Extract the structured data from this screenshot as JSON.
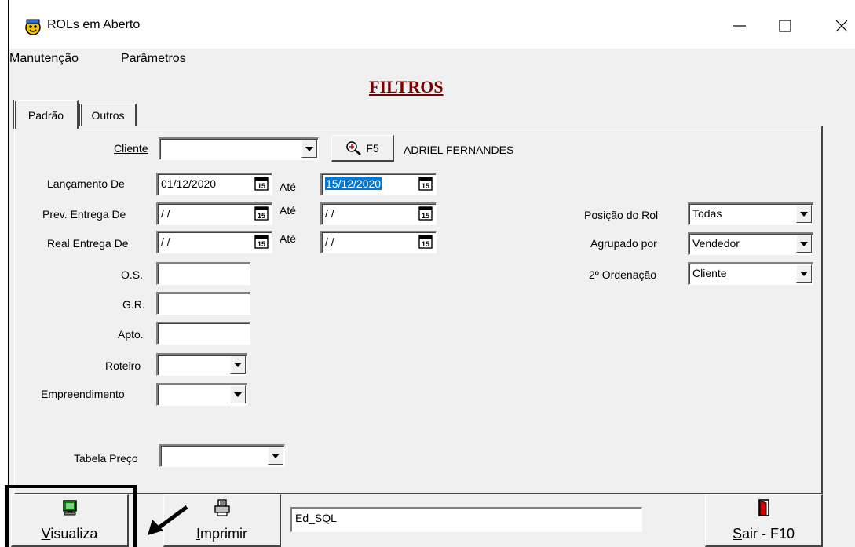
{
  "window": {
    "title": "ROLs em Aberto",
    "controls": {
      "minimize": "—",
      "maximize": "☐",
      "close": "✕"
    }
  },
  "menu": {
    "items": [
      "Manutenção",
      "Parâmetros"
    ]
  },
  "header": {
    "title": "FILTROS"
  },
  "tabs": [
    {
      "label": "Padrão",
      "active": true
    },
    {
      "label": "Outros",
      "active": false
    }
  ],
  "form": {
    "cliente": {
      "label": "Cliente",
      "value": "",
      "lookup_label": "F5",
      "client_name": "ADRIEL FERNANDES"
    },
    "lancamento": {
      "label": "Lançamento De",
      "from": "01/12/2020",
      "to_label": "Até",
      "to": "15/12/2020"
    },
    "prev_entrega": {
      "label": "Prev. Entrega De",
      "from": " / /",
      "to_label": "Até",
      "to": " / /"
    },
    "real_entrega": {
      "label": "Real Entrega De",
      "from": " / /",
      "to_label": "Até",
      "to": " / /"
    },
    "os": {
      "label": "O.S.",
      "value": ""
    },
    "gr": {
      "label": "G.R.",
      "value": ""
    },
    "apto": {
      "label": "Apto.",
      "value": ""
    },
    "roteiro": {
      "label": "Roteiro",
      "value": ""
    },
    "empreendimento": {
      "label": "Empreendimento",
      "value": ""
    },
    "tabela_preco": {
      "label": "Tabela Preço",
      "value": ""
    },
    "posicao_rol": {
      "label": "Posição do Rol",
      "value": "Todas"
    },
    "agrupado_por": {
      "label": "Agrupado por",
      "value": "Vendedor"
    },
    "ordenacao": {
      "label": "2º Ordenação",
      "value": "Cliente"
    }
  },
  "footer": {
    "visualiza": {
      "label_underlined": "V",
      "label_rest": "isualiza"
    },
    "imprimir": {
      "label_underlined": "I",
      "label_rest": "mprimir"
    },
    "sql_field": {
      "value": "Ed_SQL"
    },
    "sair": {
      "label_underlined": "S",
      "label_rest": "air - F10"
    }
  },
  "colors": {
    "title_accent": "#7a0000",
    "selection": "#0078d7",
    "face": "#f0f0f0"
  }
}
